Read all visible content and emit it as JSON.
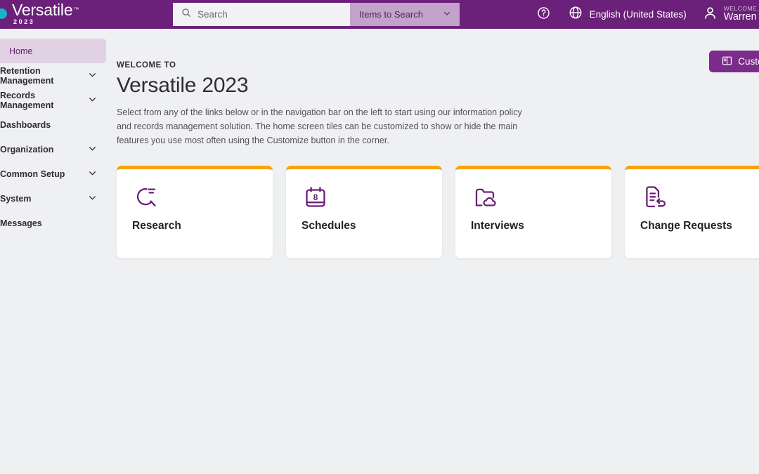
{
  "header": {
    "logo": {
      "word": "Versatile",
      "tm": "™",
      "year": "2023",
      "dot_color": "#17b3c9"
    },
    "search": {
      "placeholder": "Search",
      "scope_label": "Items to Search",
      "icon": "search-icon",
      "chevron": "chevron-down-icon"
    },
    "help_icon": "help-circle-icon",
    "language": {
      "icon": "globe-icon",
      "label": "English (United States)"
    },
    "user": {
      "icon": "person-icon",
      "welcome": "WELCOME,",
      "name": "Warren"
    },
    "background_color": "#6b2079"
  },
  "sidebar": {
    "items": [
      {
        "label": "Home",
        "active": true,
        "expandable": false
      },
      {
        "label": "Retention Management",
        "active": false,
        "expandable": true
      },
      {
        "label": "Records Management",
        "active": false,
        "expandable": true
      },
      {
        "label": "Dashboards",
        "active": false,
        "expandable": false
      },
      {
        "label": "Organization",
        "active": false,
        "expandable": true
      },
      {
        "label": "Common Setup",
        "active": false,
        "expandable": true
      },
      {
        "label": "System",
        "active": false,
        "expandable": true
      },
      {
        "label": "Messages",
        "active": false,
        "expandable": false
      }
    ],
    "active_background": "#e0d2e4",
    "active_text_color": "#6b2079"
  },
  "main": {
    "eyebrow": "WELCOME TO",
    "title": "Versatile 2023",
    "description": "Select from any of the links below or in the navigation bar on the left to start using our information policy and records management solution. The home screen tiles can be customized to show or hide the main features you use most often using the Customize button in the corner.",
    "customize_button": {
      "label": "Customize",
      "icon": "customize-layout-icon",
      "color": "#7b2c8a"
    },
    "tiles": [
      {
        "label": "Research",
        "icon": "research-magnifier-icon"
      },
      {
        "label": "Schedules",
        "icon": "calendar-8-icon",
        "badge": "8"
      },
      {
        "label": "Interviews",
        "icon": "folder-cloud-icon"
      },
      {
        "label": "Change Requests",
        "icon": "document-return-icon"
      }
    ],
    "tile_accent_color": "#f7a400"
  }
}
